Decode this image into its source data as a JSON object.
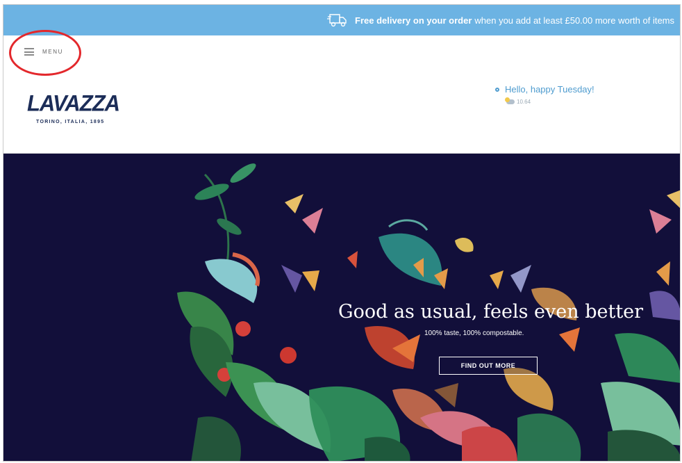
{
  "promo": {
    "bold_text": "Free delivery on your order",
    "rest_text": "when you add at least £50.00 more worth of items"
  },
  "header": {
    "menu_label": "MENU",
    "brand": "LAVAZZA",
    "tagline": "TORINO, ITALIA, 1895",
    "greeting": "Hello, happy Tuesday!",
    "weather": "10.64"
  },
  "hero": {
    "headline": "Good as usual, feels even better",
    "subheadline": "100% taste, 100% compostable.",
    "cta_label": "FIND OUT MORE"
  },
  "colors": {
    "promo_bg": "#6cb3e3",
    "brand_navy": "#1c2d58",
    "hero_bg": "#120f3a",
    "highlight": "#e3282c"
  }
}
